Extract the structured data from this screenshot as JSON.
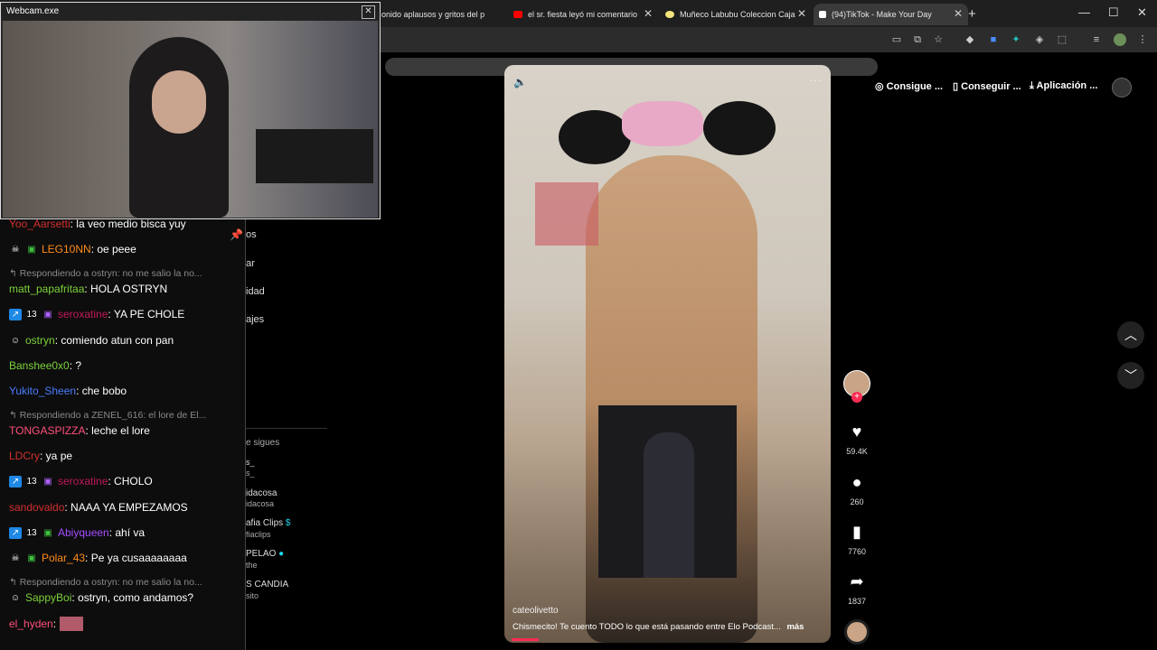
{
  "browser": {
    "tabs": [
      {
        "title": "onido aplausos y gritos del p",
        "favicon_color": "#ffffff"
      },
      {
        "title": "el sr. fiesta leyó mi comentario",
        "favicon_color": "#ff0000"
      },
      {
        "title": "Muñeco Labubu Coleccion Caja",
        "favicon_color": "#f3e37a"
      },
      {
        "title": "(94)TikTok - Make Your Day",
        "favicon_color": "#ffffff"
      }
    ],
    "new_tab": "+",
    "window_controls": {
      "minimize": "—",
      "maximize": "☐",
      "close": "✕"
    }
  },
  "webcam": {
    "title": "Webcam.exe",
    "close": "✕"
  },
  "chat": {
    "messages": [
      {
        "user": "Yoo_Aarsetti",
        "text": ": la veo medio bisca yuy",
        "color": "#d32f2f",
        "badges": []
      },
      {
        "user": "LEG10NN",
        "text": ": oe peee",
        "color": "#ff8c1a",
        "badges": [
          "skull",
          "gift-green"
        ]
      },
      {
        "reply": "Respondiendo a ostryn: no me salio la no..."
      },
      {
        "user": "matt_papafritaa",
        "text": ": HOLA OSTRYN",
        "color": "#7cd13b",
        "badges": []
      },
      {
        "user": "seroxatine",
        "text": ": YA PE CHOLE",
        "color": "#c2185b",
        "badges": [
          "prime",
          "13",
          "gift-purple"
        ]
      },
      {
        "user": "ostryn",
        "text": ": comiendo atun con pan",
        "color": "#7cd13b",
        "badges": [
          "alien"
        ]
      },
      {
        "user": "Banshee0x0",
        "text": ": ?",
        "color": "#7cd13b",
        "badges": []
      },
      {
        "user": "Yukito_Sheen",
        "text": ": che bobo",
        "color": "#4a7cff",
        "badges": []
      },
      {
        "reply": "Respondiendo a ZENEL_616: el lore de El..."
      },
      {
        "user": "TONGASPIZZA",
        "text": ": leche el lore",
        "color": "#ff4f7b",
        "badges": []
      },
      {
        "user": "LDCry",
        "text": ": ya pe",
        "color": "#d32f2f",
        "badges": []
      },
      {
        "user": "seroxatine",
        "text": ": CHOLO",
        "color": "#c2185b",
        "badges": [
          "prime",
          "13",
          "gift-purple"
        ]
      },
      {
        "user": "sandovaldo",
        "text": ": NAAA YA EMPEZAMOS",
        "color": "#d32f2f",
        "badges": []
      },
      {
        "user": "Abiyqueen",
        "text": ": ahí va",
        "color": "#a64dff",
        "badges": [
          "prime",
          "13",
          "gift-green"
        ]
      },
      {
        "user": "Polar_43",
        "text": ": Pe ya cusaaaaaaaa",
        "color": "#ff8c1a",
        "badges": [
          "skull",
          "gift-green"
        ]
      },
      {
        "reply": "Respondiendo a ostryn: no me salio la no..."
      },
      {
        "user": "SappyBoi",
        "text": ": ostryn, como andamos?",
        "color": "#7cd13b",
        "badges": [
          "alien"
        ]
      },
      {
        "user": "el_hyden",
        "text": ":",
        "color": "#ff4f7b",
        "badges": []
      }
    ],
    "pin_icon": "📌"
  },
  "sidebar_fragments": [
    {
      "text": "os"
    },
    {
      "text": "ar"
    },
    {
      "text": "idad"
    },
    {
      "text": "ajes"
    },
    {
      "text": "e sigues"
    },
    {
      "text": "s_"
    },
    {
      "text": "s_"
    },
    {
      "text": "idacosa"
    },
    {
      "text": "idacosa"
    },
    {
      "text": "afia Clips"
    },
    {
      "text": "fiaclips"
    },
    {
      "text": "PELAO"
    },
    {
      "text": "the"
    },
    {
      "text": "S CANDIA"
    },
    {
      "text": "sito"
    }
  ],
  "tiktok": {
    "top_buttons": [
      "Consigue ...",
      "Conseguir ...",
      "Aplicación ..."
    ],
    "video": {
      "username": "cateolivetto",
      "caption": "Chismecito! Te cuento TODO lo que está pasando entre Elo Podcast...",
      "more": "más",
      "mute_icon": "🔈",
      "menu_icon": "···"
    },
    "actions": {
      "likes": "59.4K",
      "comments": "260",
      "saves": "7760",
      "shares": "1837"
    },
    "accent": "#fe2c55"
  }
}
